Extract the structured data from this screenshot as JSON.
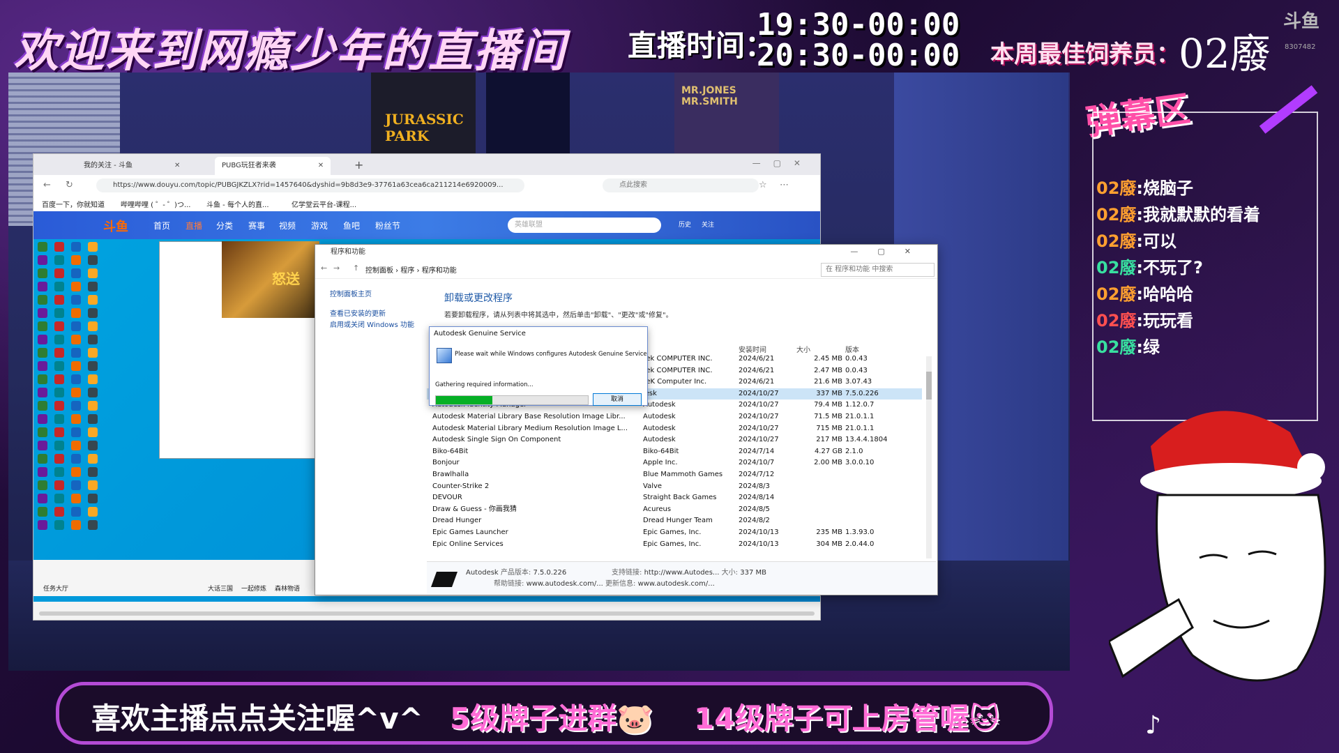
{
  "overlay": {
    "banner": "欢迎来到网瘾少年的直播间",
    "live_time_label": "直播时间：",
    "live_time_1": "19:30-00:00",
    "live_time_2": "20:30-00:00",
    "best_feeder_label": "本周最佳饲养员：",
    "best_feeder_name": "02廢",
    "douyu_logo": "斗鱼",
    "room_number": "8307482"
  },
  "scene": {
    "poster_jurassic": "JURASSIC PARK",
    "poster_mib": "MR.JONES MR.SMITH"
  },
  "browser": {
    "tabs": [
      {
        "label": "我的关注 - 斗鱼"
      },
      {
        "label": "PUBG玩狂者来袭"
      }
    ],
    "url": "https://www.douyu.com/topic/PUBGJKZLX?rid=1457640&dyshid=9b8d3e9-37761a63cea6ca211214e6920009...",
    "search_placeholder": "点此搜索",
    "bookmarks": [
      "百度一下，你就知道",
      "哔哩哔哩 ( ゜- ゜)つ...",
      "斗鱼 - 每个人的直...",
      "亿学堂云平台-课程..."
    ]
  },
  "douyu": {
    "logo": "斗鱼",
    "nav": [
      "首页",
      "直播",
      "分类",
      "赛事",
      "视频",
      "游戏",
      "鱼吧",
      "粉丝节"
    ],
    "search_placeholder": "英雄联盟",
    "header_icons": [
      "历史",
      "关注"
    ],
    "game_banner": "怒送",
    "bottom_items": [
      "任务大厅",
      "大话三国",
      "一起修炼",
      "森林物语"
    ]
  },
  "programs": {
    "title": "程序和功能",
    "breadcrumbs": [
      "控制面板",
      "程序",
      "程序和功能"
    ],
    "search_placeholder": "在 程序和功能 中搜索",
    "side_links": [
      "控制面板主页",
      "查看已安装的更新",
      "启用或关闭 Windows 功能"
    ],
    "heading": "卸载或更改程序",
    "description": "若要卸载程序，请从列表中将其选中，然后单击\"卸载\"、\"更改\"或\"修复\"。",
    "columns": {
      "date": "安装时间",
      "size": "大小",
      "version": "版本"
    },
    "rows": [
      {
        "name": "",
        "publisher": "Tek COMPUTER INC.",
        "date": "2024/6/21",
        "size": "2.45 MB",
        "version": "0.0.43"
      },
      {
        "name": "",
        "publisher": "Tek COMPUTER INC.",
        "date": "2024/6/21",
        "size": "2.47 MB",
        "version": "0.0.43"
      },
      {
        "name": "",
        "publisher": "TeK Computer Inc.",
        "date": "2024/6/21",
        "size": "21.6 MB",
        "version": "3.07.43"
      },
      {
        "name": "",
        "publisher": "lesk",
        "date": "2024/10/27",
        "size": "337 MB",
        "version": "7.5.0.226"
      },
      {
        "name": "Autodesk Identity Manager",
        "publisher": "Autodesk",
        "date": "2024/10/27",
        "size": "79.4 MB",
        "version": "1.12.0.7"
      },
      {
        "name": "Autodesk Material Library Base Resolution Image Libr...",
        "publisher": "Autodesk",
        "date": "2024/10/27",
        "size": "71.5 MB",
        "version": "21.0.1.1"
      },
      {
        "name": "Autodesk Material Library Medium Resolution Image L...",
        "publisher": "Autodesk",
        "date": "2024/10/27",
        "size": "715 MB",
        "version": "21.0.1.1"
      },
      {
        "name": "Autodesk Single Sign On Component",
        "publisher": "Autodesk",
        "date": "2024/10/27",
        "size": "217 MB",
        "version": "13.4.4.1804"
      },
      {
        "name": "Biko-64Bit",
        "publisher": "Biko-64Bit",
        "date": "2024/7/14",
        "size": "4.27 GB",
        "version": "2.1.0"
      },
      {
        "name": "Bonjour",
        "publisher": "Apple Inc.",
        "date": "2024/10/7",
        "size": "2.00 MB",
        "version": "3.0.0.10"
      },
      {
        "name": "Brawlhalla",
        "publisher": "Blue Mammoth Games",
        "date": "2024/7/12",
        "size": "",
        "version": ""
      },
      {
        "name": "Counter-Strike 2",
        "publisher": "Valve",
        "date": "2024/8/3",
        "size": "",
        "version": ""
      },
      {
        "name": "DEVOUR",
        "publisher": "Straight Back Games",
        "date": "2024/8/14",
        "size": "",
        "version": ""
      },
      {
        "name": "Draw & Guess - 你画我猜",
        "publisher": "Acureus",
        "date": "2024/8/5",
        "size": "",
        "version": ""
      },
      {
        "name": "Dread Hunger",
        "publisher": "Dread Hunger Team",
        "date": "2024/8/2",
        "size": "",
        "version": ""
      },
      {
        "name": "Epic Games Launcher",
        "publisher": "Epic Games, Inc.",
        "date": "2024/10/13",
        "size": "235 MB",
        "version": "1.3.93.0"
      },
      {
        "name": "Epic Online Services",
        "publisher": "Epic Games, Inc.",
        "date": "2024/10/13",
        "size": "304 MB",
        "version": "2.0.44.0"
      }
    ],
    "details": {
      "publisher": "Autodesk",
      "product_version_label": "产品版本:",
      "product_version": "7.5.0.226",
      "support_link_label": "支持链接:",
      "support_link": "http://www.Autodes...",
      "size_label": "大小:",
      "size": "337 MB",
      "help_link_label": "帮助链接:",
      "help_link": "www.autodesk.com/...",
      "update_info_label": "更新信息:",
      "update_info": "www.autodesk.com/..."
    }
  },
  "dialog": {
    "title": "Autodesk Genuine Service",
    "message": "Please wait while Windows configures Autodesk Genuine Service",
    "status": "Gathering required information...",
    "progress": 0.37,
    "cancel": "取消"
  },
  "danmaku": {
    "title": "弹幕区",
    "messages": [
      {
        "user": "02廢",
        "text": ":烧脑子",
        "color": "o"
      },
      {
        "user": "02廢",
        "text": ":我就默默的看着",
        "color": "o"
      },
      {
        "user": "02廢",
        "text": ":可以",
        "color": "o"
      },
      {
        "user": "02廢",
        "text": ":不玩了?",
        "color": "g"
      },
      {
        "user": "02廢",
        "text": ":哈哈哈",
        "color": "o"
      },
      {
        "user": "02廢",
        "text": ":玩玩看",
        "color": "r"
      },
      {
        "user": "02廢",
        "text": ":绿",
        "color": "g"
      }
    ]
  },
  "bottom": {
    "text1": "喜欢主播点点关注喔^v^",
    "text2": "5级牌子进群🐷",
    "text3": "14级牌子可上房管喔🐱"
  }
}
